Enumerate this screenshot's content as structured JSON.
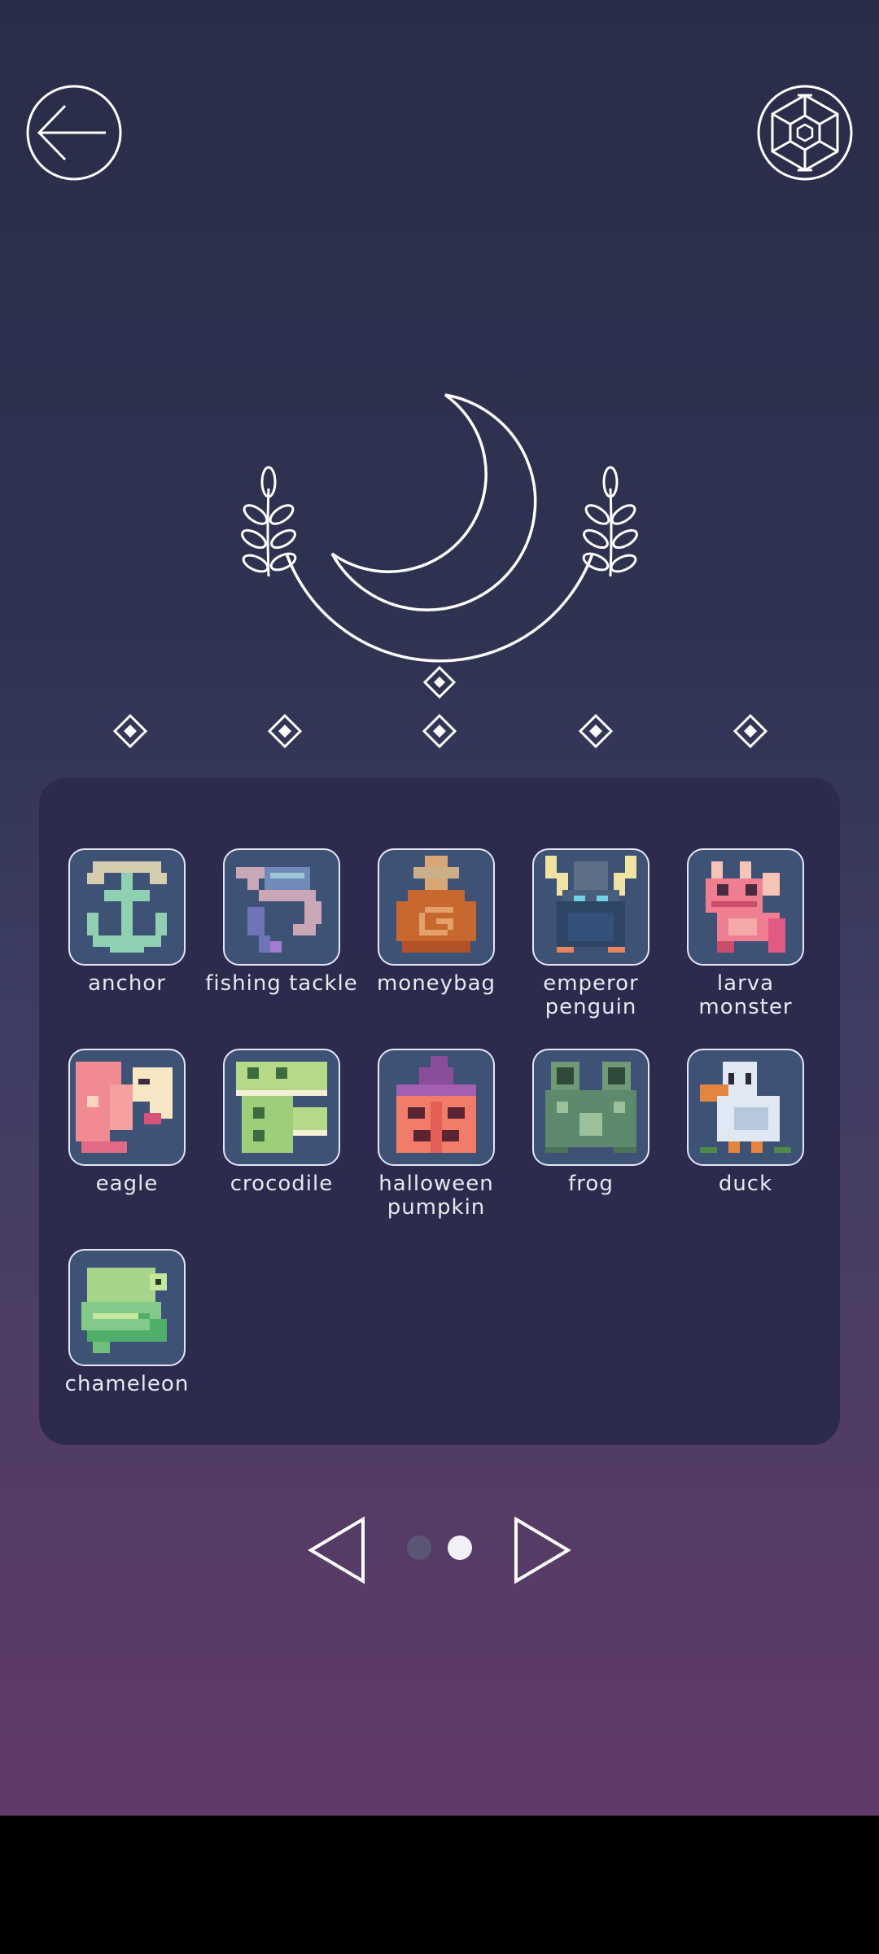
{
  "header": {
    "back_icon": "arrow-left-icon",
    "settings_icon": "hexagon-gear-icon"
  },
  "emblem": {
    "icon": "crescent-moon-laurel-emblem"
  },
  "progress": {
    "total": 5,
    "completed": 0
  },
  "collection": {
    "items": [
      {
        "label": "anchor",
        "icon": "anchor-icon",
        "colors": {
          "main": "#8fcfb2",
          "accent": "#d6cdb0"
        }
      },
      {
        "label": "fishing tackle",
        "icon": "fishing-tackle-icon",
        "colors": {
          "main": "#c9a7b6",
          "accent": "#6f74b8"
        }
      },
      {
        "label": "moneybag",
        "icon": "moneybag-icon",
        "colors": {
          "main": "#c8672e",
          "accent": "#d9a777"
        }
      },
      {
        "label": "emperor penguin",
        "icon": "emperor-penguin-icon",
        "colors": {
          "main": "#2e4566",
          "accent": "#f0e2a2"
        }
      },
      {
        "label": "larva monster",
        "icon": "larva-monster-icon",
        "colors": {
          "main": "#ef7f90",
          "accent": "#f5c4b6"
        }
      },
      {
        "label": "eagle",
        "icon": "eagle-icon",
        "colors": {
          "main": "#f08a93",
          "accent": "#f6e6c4"
        }
      },
      {
        "label": "crocodile",
        "icon": "crocodile-icon",
        "colors": {
          "main": "#b5d889",
          "accent": "#3c6c3e"
        }
      },
      {
        "label": "halloween pumpkin",
        "icon": "halloween-pumpkin-icon",
        "colors": {
          "main": "#f27c6a",
          "accent": "#8a4d9a"
        }
      },
      {
        "label": "frog",
        "icon": "frog-icon",
        "colors": {
          "main": "#5d8a6c",
          "accent": "#9cc09a"
        }
      },
      {
        "label": "duck",
        "icon": "duck-icon",
        "colors": {
          "main": "#dfe8f3",
          "accent": "#e4843f"
        }
      },
      {
        "label": "chameleon",
        "icon": "chameleon-icon",
        "colors": {
          "main": "#82c98a",
          "accent": "#c4e79b"
        }
      }
    ]
  },
  "pager": {
    "prev_icon": "triangle-left-icon",
    "next_icon": "triangle-right-icon",
    "pages": 2,
    "current": 2
  },
  "colors": {
    "tile_bg": "#3e5276",
    "panel_bg": "#2c2b4d",
    "line": "#ffffff"
  }
}
